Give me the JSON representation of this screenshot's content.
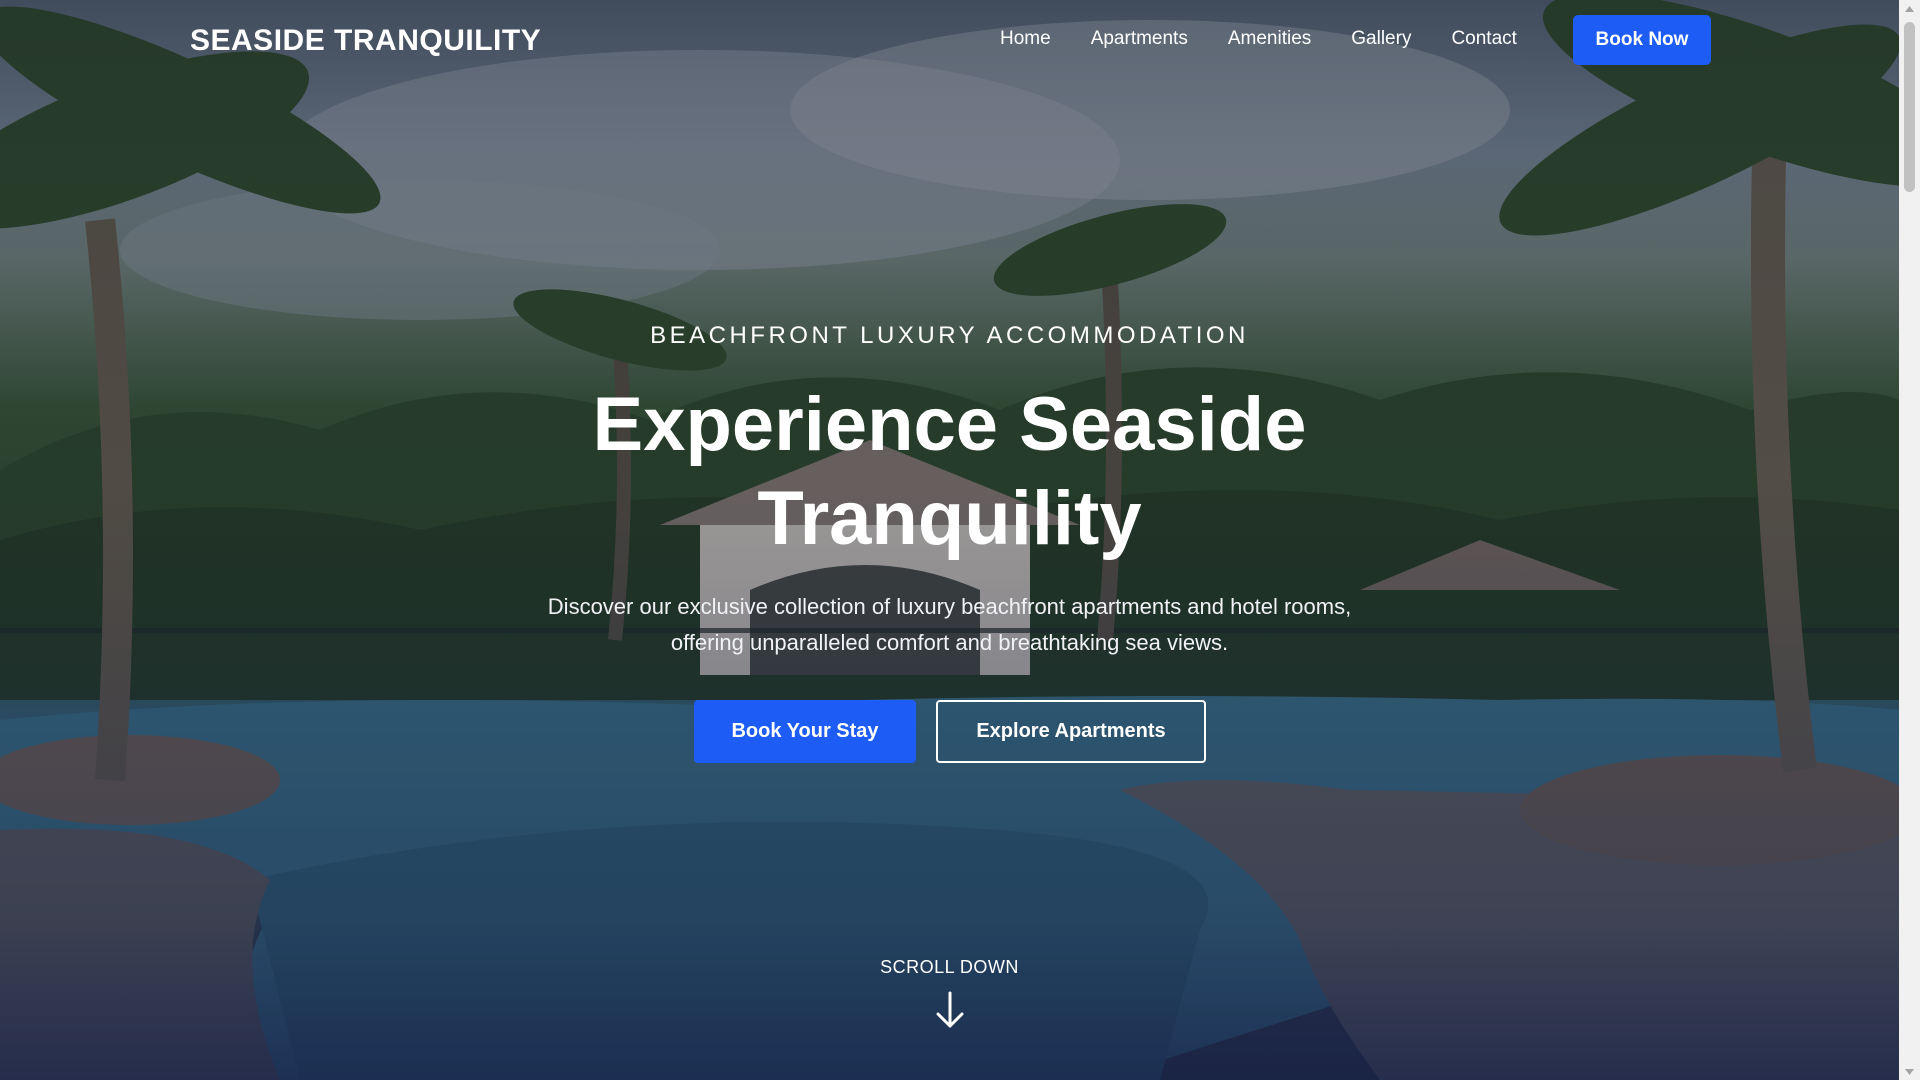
{
  "brand": {
    "name": "SEASIDE TRANQUILITY"
  },
  "nav": {
    "links": [
      "Home",
      "Apartments",
      "Amenities",
      "Gallery",
      "Contact"
    ],
    "cta": "Book Now"
  },
  "hero": {
    "eyebrow": "BEACHFRONT LUXURY ACCOMMODATION",
    "headline_line1": "Experience Seaside",
    "headline_line2": "Tranquility",
    "subtext_line1": "Discover our exclusive collection of luxury beachfront apartments and hotel rooms,",
    "subtext_line2": "offering unparalleled comfort and breathtaking sea views.",
    "primary_button": "Book Your Stay",
    "secondary_button": "Explore Apartments",
    "scroll_label": "SCROLL DOWN"
  },
  "colors": {
    "accent": "#1d5cf5",
    "text": "#ffffff"
  },
  "icons": {
    "scroll": "arrow-down-icon"
  }
}
